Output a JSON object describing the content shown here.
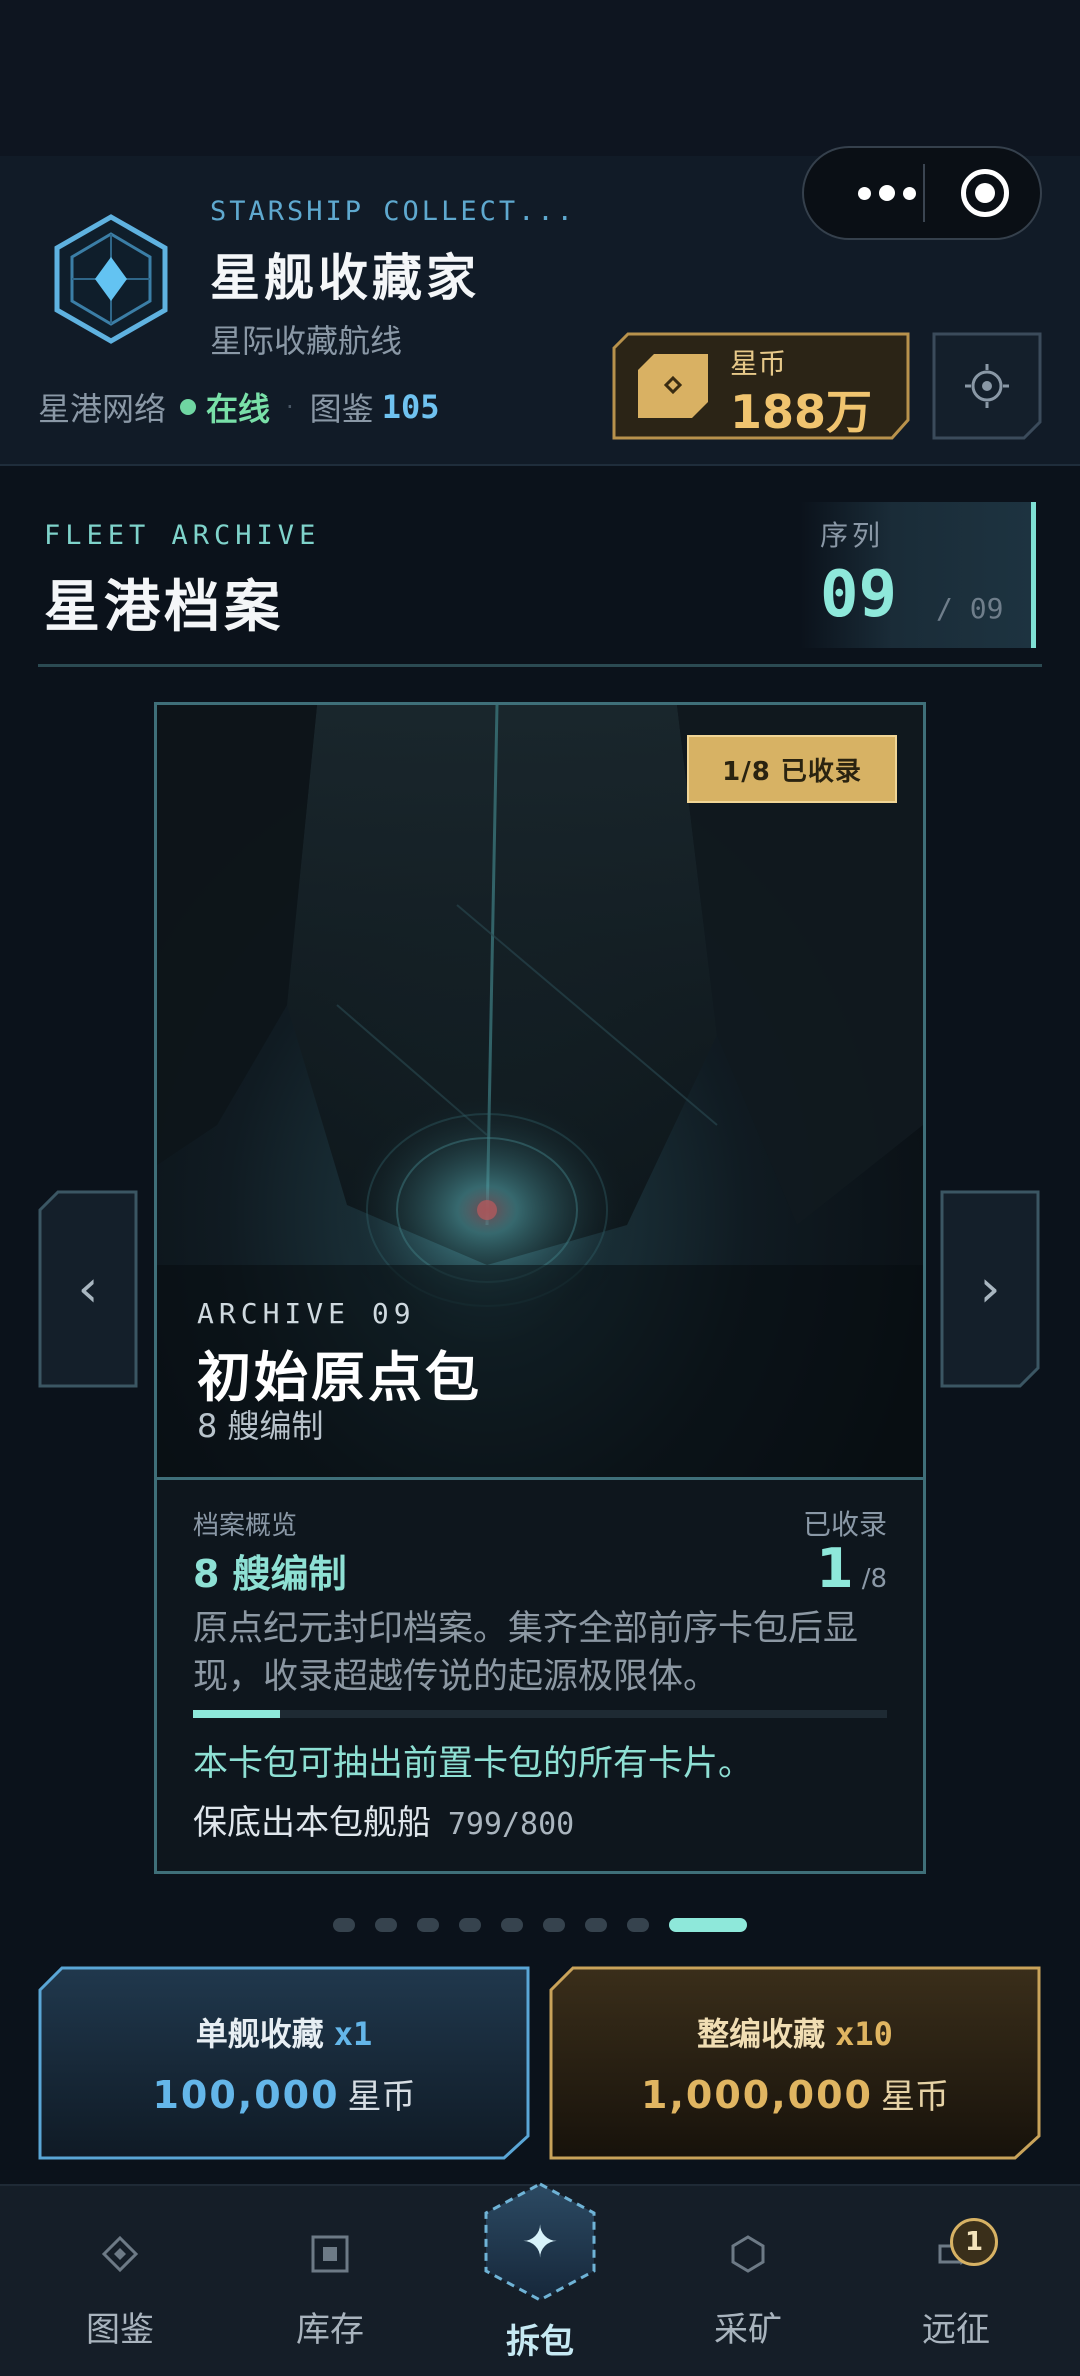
{
  "header": {
    "eyebrow": "STARSHIP COLLECT...",
    "title": "星舰收藏家",
    "subtitle": "星际收藏航线",
    "network_label": "星港网络",
    "online_label": "在线",
    "codex_label": "图鉴",
    "codex_count": "105",
    "coin_label": "星币",
    "coin_value": "188万"
  },
  "section": {
    "eyebrow": "FLEET ARCHIVE",
    "title": "星港档案",
    "sequence_label": "序列",
    "sequence_current": "09",
    "sequence_total": "/ 09"
  },
  "card": {
    "badge": "1/8 已收录",
    "archive_label": "ARCHIVE 09",
    "pack_name": "初始原点包",
    "fleet_size": "8 艘编制",
    "overview_label": "档案概览",
    "overview_value": "8 艘编制",
    "collected_label": "已收录",
    "collected_count": "1",
    "collected_total": "/8",
    "description": "原点纪元封印档案。集齐全部前序卡包后显现，收录超越传说的起源极限体。",
    "progress_fraction": 0.125,
    "hint": "本卡包可抽出前置卡包的所有卡片。",
    "guarantee_label": "保底出本包舰船",
    "guarantee_value": "799/800"
  },
  "pager": {
    "count": 9,
    "active_index": 8
  },
  "actions": {
    "single": {
      "title": "单舰收藏",
      "multiplier": "x1",
      "price": "100,000",
      "unit": "星币"
    },
    "batch": {
      "title": "整编收藏",
      "multiplier": "x10",
      "price": "1,000,000",
      "unit": "星币"
    }
  },
  "tabs": [
    {
      "label": "图鉴",
      "icon": "diamond-icon"
    },
    {
      "label": "库存",
      "icon": "box-icon"
    },
    {
      "label": "拆包",
      "icon": "sparkle-icon"
    },
    {
      "label": "采矿",
      "icon": "hexagon-icon"
    },
    {
      "label": "远征",
      "icon": "ship-icon",
      "badge": "1"
    }
  ],
  "colors": {
    "accent_teal": "#8ee8da",
    "accent_blue": "#64b6e9",
    "accent_gold": "#e0b561",
    "online_green": "#79e0a8",
    "background": "#0b121b"
  }
}
